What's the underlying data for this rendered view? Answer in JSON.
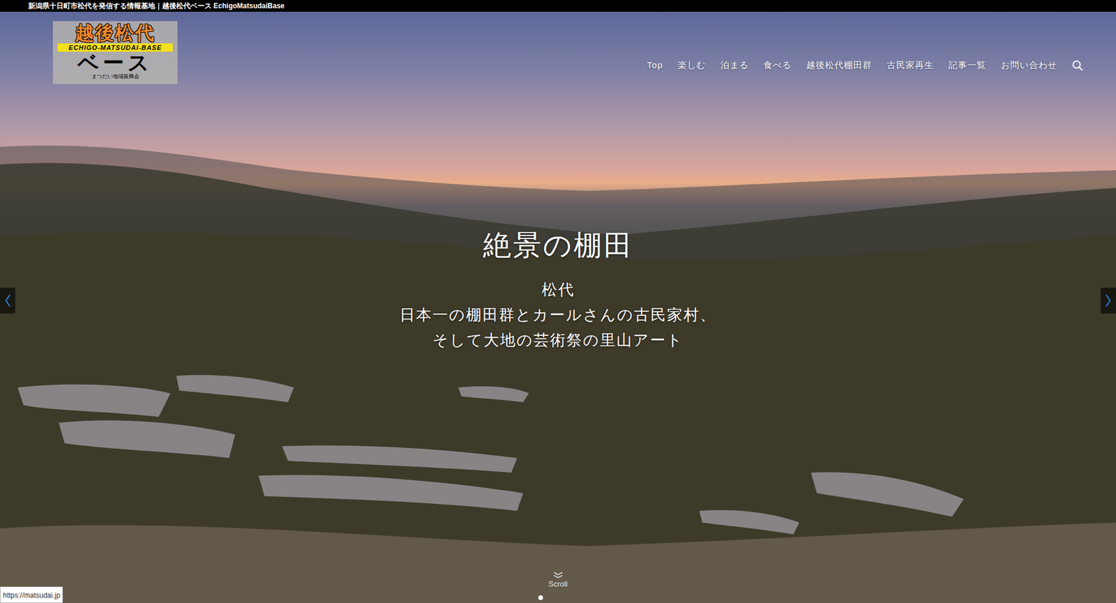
{
  "topbar": {
    "text": "新潟県十日町市松代を発信する情報基地｜越後松代ベース EchigoMatsudaiBase"
  },
  "logo": {
    "title": "越後松代",
    "band": "ECHIGO-MATSUDAI-BASE",
    "sub": "ベース",
    "org": "まつだい地域振興会"
  },
  "nav": [
    {
      "label": "Top"
    },
    {
      "label": "楽しむ"
    },
    {
      "label": "泊まる"
    },
    {
      "label": "食べる"
    },
    {
      "label": "越後松代棚田群"
    },
    {
      "label": "古民家再生"
    },
    {
      "label": "記事一覧"
    },
    {
      "label": "お問い合わせ"
    }
  ],
  "slider": {
    "title": "絶景の棚田",
    "lines": [
      "松代",
      "日本一の棚田群とカールさんの古民家村、",
      "そして大地の芸術祭の里山アート"
    ],
    "dots": [
      {
        "selected": true
      }
    ],
    "scroll": "Scroll"
  },
  "status_bar": {
    "url": "https://matsudai.jp"
  }
}
